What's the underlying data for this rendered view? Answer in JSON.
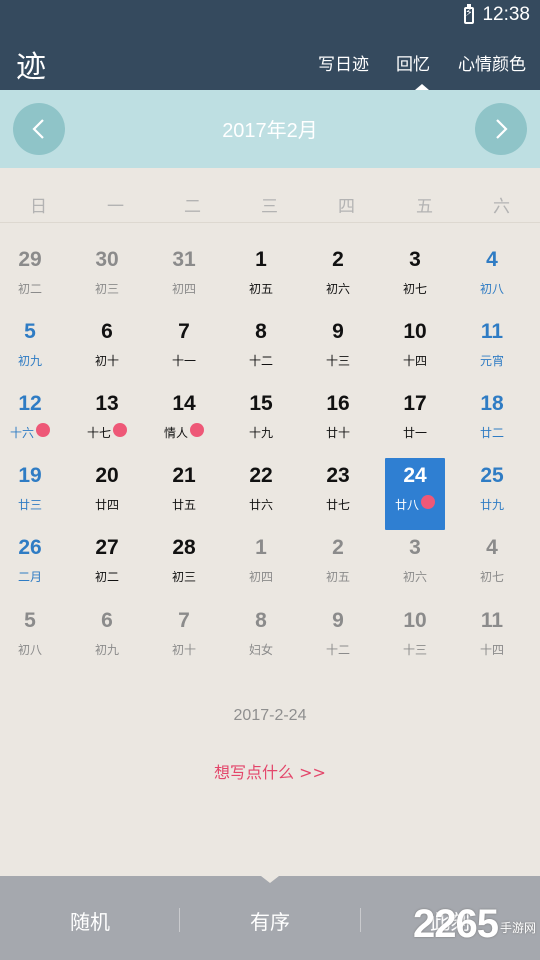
{
  "status_bar": {
    "time": "12:38",
    "battery_symbol": "⚡"
  },
  "header": {
    "logo": "迹",
    "tabs": [
      {
        "label": "写日迹"
      },
      {
        "label": "回忆",
        "active": true
      },
      {
        "label": "心情颜色"
      }
    ]
  },
  "calendar": {
    "month_title": "2017年2月",
    "weekdays": [
      "日",
      "一",
      "二",
      "三",
      "四",
      "五",
      "六"
    ],
    "days": [
      {
        "day": "29",
        "lunar": "初二",
        "style": "grey"
      },
      {
        "day": "30",
        "lunar": "初三",
        "style": "grey"
      },
      {
        "day": "31",
        "lunar": "初四",
        "style": "grey"
      },
      {
        "day": "1",
        "lunar": "初五",
        "style": "black"
      },
      {
        "day": "2",
        "lunar": "初六",
        "style": "black"
      },
      {
        "day": "3",
        "lunar": "初七",
        "style": "black"
      },
      {
        "day": "4",
        "lunar": "初八",
        "style": "blue"
      },
      {
        "day": "5",
        "lunar": "初九",
        "style": "blue"
      },
      {
        "day": "6",
        "lunar": "初十",
        "style": "black"
      },
      {
        "day": "7",
        "lunar": "十一",
        "style": "black"
      },
      {
        "day": "8",
        "lunar": "十二",
        "style": "black"
      },
      {
        "day": "9",
        "lunar": "十三",
        "style": "black"
      },
      {
        "day": "10",
        "lunar": "十四",
        "style": "black"
      },
      {
        "day": "11",
        "lunar": "元宵",
        "style": "blue"
      },
      {
        "day": "12",
        "lunar": "十六",
        "style": "blue",
        "has_entry": true
      },
      {
        "day": "13",
        "lunar": "十七",
        "style": "black",
        "has_entry": true
      },
      {
        "day": "14",
        "lunar": "情人",
        "style": "black",
        "has_entry": true
      },
      {
        "day": "15",
        "lunar": "十九",
        "style": "black"
      },
      {
        "day": "16",
        "lunar": "廿十",
        "style": "black"
      },
      {
        "day": "17",
        "lunar": "廿一",
        "style": "black"
      },
      {
        "day": "18",
        "lunar": "廿二",
        "style": "blue"
      },
      {
        "day": "19",
        "lunar": "廿三",
        "style": "blue"
      },
      {
        "day": "20",
        "lunar": "廿四",
        "style": "black"
      },
      {
        "day": "21",
        "lunar": "廿五",
        "style": "black"
      },
      {
        "day": "22",
        "lunar": "廿六",
        "style": "black"
      },
      {
        "day": "23",
        "lunar": "廿七",
        "style": "black"
      },
      {
        "day": "24",
        "lunar": "廿八",
        "style": "selected",
        "has_entry": true
      },
      {
        "day": "25",
        "lunar": "廿九",
        "style": "blue"
      },
      {
        "day": "26",
        "lunar": "二月",
        "style": "blue"
      },
      {
        "day": "27",
        "lunar": "初二",
        "style": "black"
      },
      {
        "day": "28",
        "lunar": "初三",
        "style": "black"
      },
      {
        "day": "1",
        "lunar": "初四",
        "style": "grey"
      },
      {
        "day": "2",
        "lunar": "初五",
        "style": "grey"
      },
      {
        "day": "3",
        "lunar": "初六",
        "style": "grey"
      },
      {
        "day": "4",
        "lunar": "初七",
        "style": "grey"
      },
      {
        "day": "5",
        "lunar": "初八",
        "style": "grey"
      },
      {
        "day": "6",
        "lunar": "初九",
        "style": "grey"
      },
      {
        "day": "7",
        "lunar": "初十",
        "style": "grey"
      },
      {
        "day": "8",
        "lunar": "妇女",
        "style": "grey"
      },
      {
        "day": "9",
        "lunar": "十二",
        "style": "grey"
      },
      {
        "day": "10",
        "lunar": "十三",
        "style": "grey"
      },
      {
        "day": "11",
        "lunar": "十四",
        "style": "grey"
      }
    ]
  },
  "selected_date": "2017-2-24",
  "write_prompt": "想写点什么 >>",
  "bottom_bar": {
    "buttons": [
      {
        "label": "随机"
      },
      {
        "label": "有序"
      },
      {
        "label": "此刻"
      }
    ]
  },
  "watermark": {
    "brand": "2265",
    "suffix": "手游网"
  },
  "colors": {
    "header_bg": "#354a5e",
    "month_bar_bg": "#bedfe2",
    "nav_button": "#8fc4c8",
    "selected_day": "#2f7fd2",
    "weekend_day": "#2f7cc4",
    "entry_dot": "#ee5877",
    "prompt_text": "#e3466a",
    "bottom_bar_bg": "#a5a8ae"
  }
}
